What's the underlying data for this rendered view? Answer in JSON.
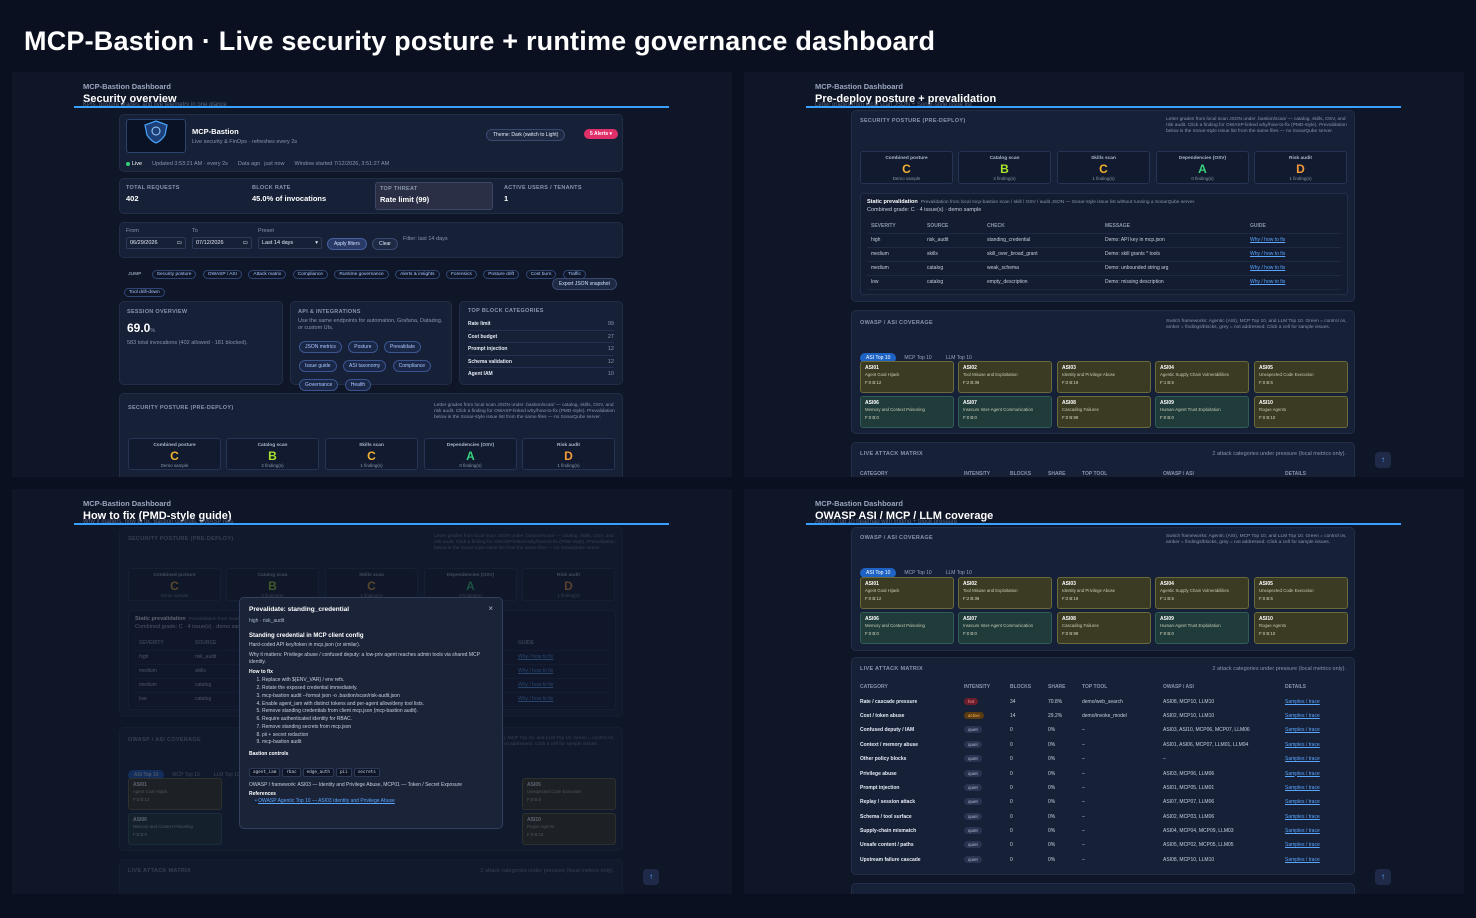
{
  "main_title": "MCP-Bastion · Live security posture + runtime governance dashboard",
  "quadrants": {
    "q1": {
      "sub": "MCP-Bastion Dashboard",
      "title": "Security overview",
      "ghost": "KPIs, posture grades, and live telemetry in one glance"
    },
    "q2": {
      "sub": "MCP-Bastion Dashboard",
      "title": "Pre-deploy posture + prevalidation",
      "ghost": "Letter grades from local scan JSON + Sonar-style issue list"
    },
    "q3": {
      "sub": "MCP-Bastion Dashboard",
      "title": "How to fix (PMD-style guide)",
      "ghost": "Why it matters, how to fix, Bastion controls, OWASP refs"
    },
    "q4": {
      "sub": "MCP-Bastion Dashboard",
      "title": "OWASP ASI / MCP / LLM coverage",
      "ghost": "Agentic Top 10 heatmap with finding + block pressure"
    }
  },
  "overview": {
    "app_name": "MCP-Bastion",
    "app_sub": "Live security & FinOps · refreshes every 2s",
    "theme_btn": "Theme: Dark (switch to Light)",
    "alerts_btn": "5 Alerts ▾",
    "live": "Live",
    "updated": "Updated 3:53:21 AM · every 2s",
    "data_ago": "Data ago",
    "just_now": "just now",
    "window": "Window started 7/12/2026, 3:51:27 AM",
    "kpis": [
      {
        "label": "TOTAL REQUESTS",
        "value": "402"
      },
      {
        "label": "BLOCK RATE",
        "value": "45.0% of invocations"
      },
      {
        "label": "TOP THREAT",
        "value": "Rate limit (99)"
      },
      {
        "label": "ACTIVE USERS / TENANTS",
        "value": "1"
      }
    ],
    "from_label": "From",
    "from_val": "06/29/2026",
    "to_label": "To",
    "to_val": "07/12/2026",
    "preset_label": "Preset",
    "preset_val": "Last 14 days",
    "apply": "Apply filters",
    "clear": "Clear",
    "filter_note": "Filter: last 14 days",
    "jump_label": "JUMP",
    "jump": [
      "Security posture",
      "OWASP / ASI",
      "Attack matrix",
      "Compliance",
      "Runtime governance",
      "Alerts & insights",
      "Forensics",
      "Posture drift",
      "Cost burn",
      "Traffic",
      "Tool drill-down"
    ],
    "export": "Export JSON snapshot",
    "session_label": "SESSION OVERVIEW",
    "session_val": "69.0",
    "session_unit": "%",
    "session_note": "583 total invocations (402 allowed · 181 blocked).",
    "api_label": "API & INTEGRATIONS",
    "api_note": "Use the same endpoints for automation, Grafana, Datadog, or custom UIs.",
    "api_chips": [
      "JSON metrics",
      "Posture",
      "Prevalidate",
      "Issue guide",
      "ASI taxonomy",
      "Compliance",
      "Governance",
      "Health"
    ],
    "top_label": "TOP BLOCK CATEGORIES",
    "top_cats": [
      {
        "name": "Rate limit",
        "val": "99"
      },
      {
        "name": "Cost budget",
        "val": "27"
      },
      {
        "name": "Prompt injection",
        "val": "12"
      },
      {
        "name": "Schema validation",
        "val": "12"
      },
      {
        "name": "Agent IAM",
        "val": "10"
      }
    ]
  },
  "posture": {
    "label": "SECURITY POSTURE (PRE-DEPLOY)",
    "desc": "Letter grades from local scan JSON under .bastion/scan/ — catalog, skills, OSV, and risk audit. Click a finding for OWASP-linked why/how-to-fix (PMD-style). Prevalidation below is the Sonar-style issue list from the same files — no SonarQube server.",
    "grades": [
      {
        "label": "Combined posture",
        "grade": "C",
        "sub": "Demo sample",
        "cls": "gC"
      },
      {
        "label": "Catalog scan",
        "grade": "B",
        "sub": "2 finding(s)",
        "cls": "gB"
      },
      {
        "label": "Skills scan",
        "grade": "C",
        "sub": "1 finding(s)",
        "cls": "gC"
      },
      {
        "label": "Dependencies (OSV)",
        "grade": "A",
        "sub": "0 finding(s)",
        "cls": "gA"
      },
      {
        "label": "Risk audit",
        "grade": "D",
        "sub": "1 finding(s)",
        "cls": "gD"
      }
    ]
  },
  "prevalidation": {
    "title": "Static prevalidation",
    "desc": "Prevalidation from local mcp-bastion scan / skill / OSV / audit JSON — Sonar-style issue list without running a SonarQube server.",
    "combined": "Combined grade: C · 4 issue(s) · demo sample",
    "headers": [
      "SEVERITY",
      "SOURCE",
      "CHECK",
      "MESSAGE",
      "GUIDE"
    ],
    "rows": [
      [
        "high",
        "risk_audit",
        "standing_credential",
        "Demo: API key in mcp.json",
        "Why / how to fix"
      ],
      [
        "medium",
        "skills",
        "skill_over_broad_grant",
        "Demo: skill grants * tools",
        "Why / how to fix"
      ],
      [
        "medium",
        "catalog",
        "weak_schema",
        "Demo: unbounded string arg",
        "Why / how to fix"
      ],
      [
        "low",
        "catalog",
        "empty_description",
        "Demo: missing description",
        "Why / how to fix"
      ]
    ]
  },
  "owasp": {
    "label": "OWASP / ASI COVERAGE",
    "desc": "Switch frameworks: Agentic (ASI), MCP Top 10, and LLM Top 10. Green = control on, amber = findings/blocks, grey = not addressed. Click a cell for sample issues.",
    "tabs": [
      "ASI Top 10",
      "MCP Top 10",
      "LLM Top 10"
    ],
    "cards": [
      {
        "id": "ASI01",
        "name": "Agent Goal Hijack",
        "fb": "F:0 B:12",
        "green": false
      },
      {
        "id": "ASI02",
        "name": "Tool Misuse and Exploitation",
        "fb": "F:2 B:39",
        "green": false
      },
      {
        "id": "ASI03",
        "name": "Identity and Privilege Abuse",
        "fb": "F:2 B:19",
        "green": false
      },
      {
        "id": "ASI04",
        "name": "Agentic Supply Chain Vulnerabilities",
        "fb": "F:1 B:6",
        "green": false
      },
      {
        "id": "ASI05",
        "name": "Unexpected Code Execution",
        "fb": "F:0 B:6",
        "green": false
      },
      {
        "id": "ASI06",
        "name": "Memory and Context Poisoning",
        "fb": "F:0 B:0",
        "green": true
      },
      {
        "id": "ASI07",
        "name": "Insecure Inter-Agent Communication",
        "fb": "F:0 B:0",
        "green": true
      },
      {
        "id": "ASI08",
        "name": "Cascading Failures",
        "fb": "F:0 B:99",
        "green": false
      },
      {
        "id": "ASI09",
        "name": "Human-Agent Trust Exploitation",
        "fb": "F:0 B:0",
        "green": true
      },
      {
        "id": "ASI10",
        "name": "Rogue Agents",
        "fb": "F:0 B:10",
        "green": false
      }
    ]
  },
  "attack": {
    "label": "LIVE ATTACK MATRIX",
    "note": "2 attack categories under pressure (local metrics only).",
    "headers": [
      "CATEGORY",
      "INTENSITY",
      "BLOCKS",
      "SHARE",
      "TOP TOOL",
      "OWASP / ASI",
      "DETAILS"
    ],
    "rows": [
      [
        "Rate / cascade pressure",
        "hot",
        "34",
        "70.8%",
        "demo/web_search",
        "ASI08, MCP10, LLM10",
        "Samples / trace"
      ],
      [
        "Cost / token abuse",
        "active",
        "14",
        "29.2%",
        "demo/invoke_model",
        "ASI02, MCP10, LLM10",
        "Samples / trace"
      ],
      [
        "Confused deputy / IAM",
        "quiet",
        "0",
        "0%",
        "–",
        "ASI03, ASI10, MCP06, MCP07, LLM06",
        "Samples / trace"
      ],
      [
        "Context / memory abuse",
        "quiet",
        "0",
        "0%",
        "–",
        "ASI01, ASI06, MCP07, LLM01, LLM04",
        "Samples / trace"
      ],
      [
        "Other policy blocks",
        "quiet",
        "0",
        "0%",
        "–",
        "–",
        "Samples / trace"
      ],
      [
        "Privilege abuse",
        "quiet",
        "0",
        "0%",
        "–",
        "ASI03, MCP06, LLM06",
        "Samples / trace"
      ],
      [
        "Prompt injection",
        "quiet",
        "0",
        "0%",
        "–",
        "ASI01, MCP05, LLM01",
        "Samples / trace"
      ],
      [
        "Replay / session attack",
        "quiet",
        "0",
        "0%",
        "–",
        "ASI07, MCP07, LLM06",
        "Samples / trace"
      ],
      [
        "Schema / tool surface",
        "quiet",
        "0",
        "0%",
        "–",
        "ASI02, MCP03, LLM06",
        "Samples / trace"
      ],
      [
        "Supply-chain mismatch",
        "quiet",
        "0",
        "0%",
        "–",
        "ASI04, MCP04, MCP09, LLM03",
        "Samples / trace"
      ],
      [
        "Unsafe content / paths",
        "quiet",
        "0",
        "0%",
        "–",
        "ASI05, MCP02, MCP05, LLM05",
        "Samples / trace"
      ],
      [
        "Upstream failure cascade",
        "quiet",
        "0",
        "0%",
        "–",
        "ASI08, MCP10, LLM10",
        "Samples / trace"
      ]
    ]
  },
  "modal": {
    "title": "Prevalidate: standing_credential",
    "sub": "high · risk_audit",
    "close": "×",
    "heading": "Standing credential in MCP client config",
    "desc": "Hard-coded API key/token in mcp.json (or similar).",
    "why": "Why it matters: Privilege abuse / confused deputy: a low-priv agent reaches admin tools via shared MCP identity.",
    "how_label": "How to fix",
    "steps": [
      "Replace with ${ENV_VAR} / env refs.",
      "Rotate the exposed credential immediately.",
      "mcp-bastion audit --format json -o .bastion/scan/risk-audit.json",
      "Enable agent_iam with distinct tokens and per-agent allow/deny tool lists.",
      "Remove standing credentials from client mcp.json (mcp-bastion audit).",
      "Require authenticated identity for RBAC.",
      "Remove standing secrets from mcp.json",
      "pii + secret redaction",
      "mcp-bastion audit"
    ],
    "controls_label": "Bastion controls",
    "controls": [
      "agent_iam",
      "rbac",
      "edge_auth",
      "pii",
      "secrets"
    ],
    "framework": "OWASP / framework: ASI03 — Identity and Privilege Abuse, MCP01 — Token / Secret Exposure",
    "refs_label": "References",
    "ref": "OWASP Agentic Top 10 — ASI03 Identity and Privilege Abuse"
  },
  "scroll_up": "↑"
}
